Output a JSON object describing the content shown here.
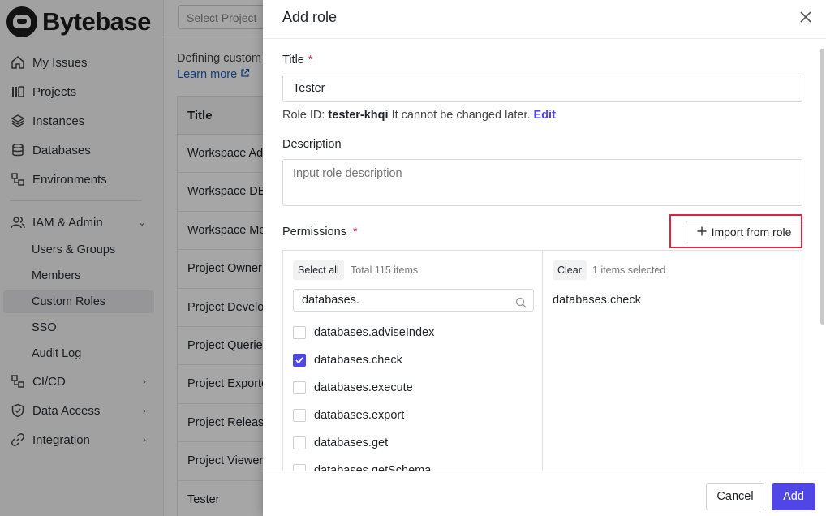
{
  "app": {
    "logo_text": "Bytebase"
  },
  "sidebar": {
    "items": [
      {
        "label": "My Issues",
        "icon": "home-icon"
      },
      {
        "label": "Projects",
        "icon": "projects-icon"
      },
      {
        "label": "Instances",
        "icon": "layers-icon"
      },
      {
        "label": "Databases",
        "icon": "database-icon"
      },
      {
        "label": "Environments",
        "icon": "environments-icon"
      },
      {
        "label": "IAM & Admin",
        "icon": "users-icon"
      },
      {
        "label": "CI/CD",
        "icon": "cicd-icon"
      },
      {
        "label": "Data Access",
        "icon": "shield-icon"
      },
      {
        "label": "Integration",
        "icon": "link-icon"
      }
    ],
    "iam_sub": [
      "Users & Groups",
      "Members",
      "Custom Roles",
      "SSO",
      "Audit Log"
    ]
  },
  "main": {
    "select_project_placeholder": "Select Project",
    "description": "Defining custom",
    "learn_more": "Learn more",
    "table_header": "Title",
    "rows": [
      "Workspace Ad",
      "Workspace DB",
      "Workspace Me",
      "Project Owner",
      "Project Develo",
      "Project Querie",
      "Project Exporte",
      "Project Releas",
      "Project Viewer",
      "Tester"
    ]
  },
  "drawer": {
    "title": "Add role",
    "title_label": "Title",
    "title_value": "Tester",
    "role_id_prefix": "Role ID:",
    "role_id": "tester-khqi",
    "role_id_note": "It cannot be changed later.",
    "edit_label": "Edit",
    "description_label": "Description",
    "description_placeholder": "Input role description",
    "permissions_label": "Permissions",
    "import_label": "Import from role",
    "left": {
      "select_all": "Select all",
      "total": "Total 115 items",
      "search_value": "databases.",
      "options": [
        {
          "label": "databases.adviseIndex",
          "checked": false
        },
        {
          "label": "databases.check",
          "checked": true
        },
        {
          "label": "databases.execute",
          "checked": false
        },
        {
          "label": "databases.export",
          "checked": false
        },
        {
          "label": "databases.get",
          "checked": false
        },
        {
          "label": "databases.getSchema",
          "checked": false
        }
      ]
    },
    "right": {
      "clear": "Clear",
      "selected_count": "1 items selected",
      "selected": [
        "databases.check"
      ]
    },
    "cancel_label": "Cancel",
    "add_label": "Add"
  },
  "colors": {
    "accent": "#4f46e5",
    "required": "#d03050",
    "highlight": "#e0243f"
  }
}
